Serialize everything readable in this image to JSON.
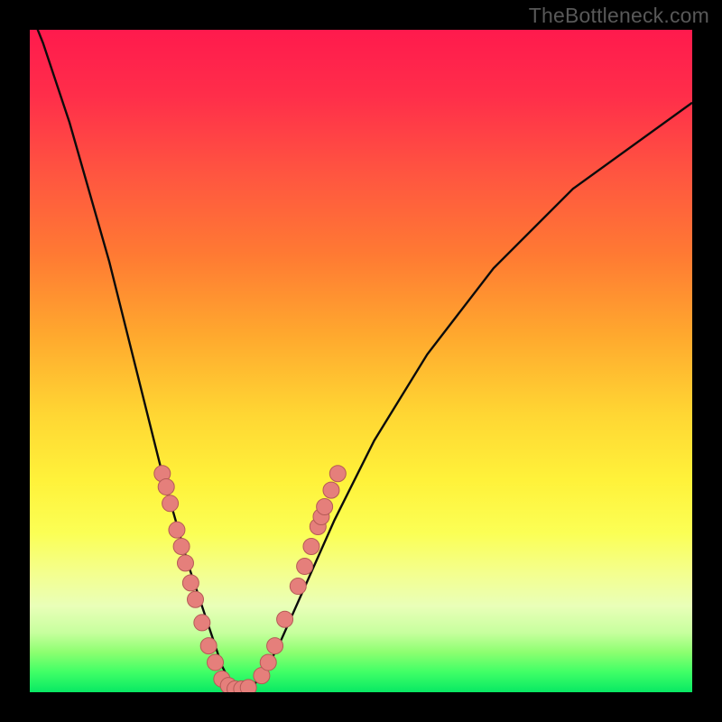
{
  "attribution": "TheBottleneck.com",
  "colors": {
    "marker_fill": "#e57f7b",
    "marker_stroke": "#b55a56",
    "curve_stroke": "#0b0b0b"
  },
  "chart_data": {
    "type": "line",
    "title": "",
    "xlabel": "",
    "ylabel": "",
    "xlim": [
      0,
      100
    ],
    "ylim": [
      0,
      100
    ],
    "series": [
      {
        "name": "bottleneck-curve",
        "x": [
          0,
          2,
          4,
          6,
          8,
          10,
          12,
          14,
          16,
          18,
          20,
          22,
          24,
          26,
          28,
          29,
          30,
          31,
          32,
          33,
          34,
          36,
          38,
          42,
          46,
          52,
          60,
          70,
          82,
          100
        ],
        "values": [
          103,
          98,
          92,
          86,
          79,
          72,
          65,
          57,
          49,
          41,
          33,
          26,
          19,
          13,
          7,
          4,
          2,
          0.7,
          0.5,
          0.6,
          1.3,
          4,
          8,
          17,
          26,
          38,
          51,
          64,
          76,
          89
        ]
      }
    ],
    "markers": [
      {
        "x": 20.0,
        "y": 33
      },
      {
        "x": 20.6,
        "y": 31
      },
      {
        "x": 21.2,
        "y": 28.5
      },
      {
        "x": 22.2,
        "y": 24.5
      },
      {
        "x": 22.9,
        "y": 22
      },
      {
        "x": 23.5,
        "y": 19.5
      },
      {
        "x": 24.3,
        "y": 16.5
      },
      {
        "x": 25.0,
        "y": 14
      },
      {
        "x": 26.0,
        "y": 10.5
      },
      {
        "x": 27.0,
        "y": 7
      },
      {
        "x": 28.0,
        "y": 4.5
      },
      {
        "x": 29.0,
        "y": 2
      },
      {
        "x": 30.0,
        "y": 1
      },
      {
        "x": 31.0,
        "y": 0.5
      },
      {
        "x": 32.0,
        "y": 0.5
      },
      {
        "x": 33.0,
        "y": 0.7
      },
      {
        "x": 35.0,
        "y": 2.5
      },
      {
        "x": 36.0,
        "y": 4.5
      },
      {
        "x": 37.0,
        "y": 7
      },
      {
        "x": 38.5,
        "y": 11
      },
      {
        "x": 40.5,
        "y": 16
      },
      {
        "x": 41.5,
        "y": 19
      },
      {
        "x": 42.5,
        "y": 22
      },
      {
        "x": 43.5,
        "y": 25
      },
      {
        "x": 44.0,
        "y": 26.5
      },
      {
        "x": 44.5,
        "y": 28
      },
      {
        "x": 45.5,
        "y": 30.5
      },
      {
        "x": 46.5,
        "y": 33
      }
    ],
    "marker_radius_px": 9
  }
}
